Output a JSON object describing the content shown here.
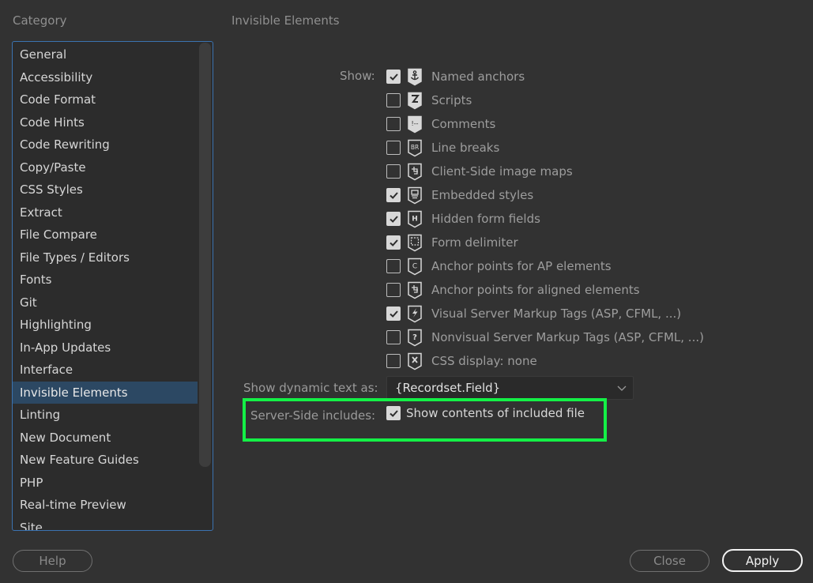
{
  "category": {
    "title": "Category",
    "items": [
      {
        "label": "General"
      },
      {
        "label": "Accessibility"
      },
      {
        "label": "Code Format"
      },
      {
        "label": "Code Hints"
      },
      {
        "label": "Code Rewriting"
      },
      {
        "label": "Copy/Paste"
      },
      {
        "label": "CSS Styles"
      },
      {
        "label": "Extract"
      },
      {
        "label": "File Compare"
      },
      {
        "label": "File Types / Editors"
      },
      {
        "label": "Fonts"
      },
      {
        "label": "Git"
      },
      {
        "label": "Highlighting"
      },
      {
        "label": "In-App Updates"
      },
      {
        "label": "Interface"
      },
      {
        "label": "Invisible Elements"
      },
      {
        "label": "Linting"
      },
      {
        "label": "New Document"
      },
      {
        "label": "New Feature Guides"
      },
      {
        "label": "PHP"
      },
      {
        "label": "Real-time Preview"
      },
      {
        "label": "Site"
      }
    ],
    "selected": "Invisible Elements"
  },
  "panel": {
    "title": "Invisible Elements",
    "show_label": "Show:",
    "options": [
      {
        "label": "Named anchors",
        "checked": true,
        "icon": "anchor-icon"
      },
      {
        "label": "Scripts",
        "checked": false,
        "icon": "script-icon"
      },
      {
        "label": "Comments",
        "checked": false,
        "icon": "comment-icon"
      },
      {
        "label": "Line breaks",
        "checked": false,
        "icon": "line-break-icon"
      },
      {
        "label": "Client-Side image maps",
        "checked": false,
        "icon": "image-map-icon"
      },
      {
        "label": "Embedded styles",
        "checked": true,
        "icon": "embedded-style-icon"
      },
      {
        "label": "Hidden form fields",
        "checked": true,
        "icon": "hidden-field-icon"
      },
      {
        "label": "Form delimiter",
        "checked": true,
        "icon": "form-delimiter-icon"
      },
      {
        "label": "Anchor points for AP elements",
        "checked": false,
        "icon": "ap-anchor-icon"
      },
      {
        "label": "Anchor points for aligned elements",
        "checked": false,
        "icon": "aligned-anchor-icon"
      },
      {
        "label": "Visual Server Markup Tags (ASP, CFML, ...)",
        "checked": true,
        "icon": "visual-server-tag-icon"
      },
      {
        "label": "Nonvisual Server Markup Tags (ASP, CFML, ...)",
        "checked": false,
        "icon": "nonvisual-server-tag-icon"
      },
      {
        "label": "CSS display: none",
        "checked": false,
        "icon": "css-display-none-icon"
      }
    ],
    "dynamic_text": {
      "label": "Show dynamic text as:",
      "value": "{Recordset.Field}"
    },
    "ssi": {
      "label": "Server-Side includes:",
      "checkbox_label": "Show contents of included file",
      "checked": true
    },
    "highlight_color": "#14f046"
  },
  "footer": {
    "help_label": "Help",
    "close_label": "Close",
    "apply_label": "Apply"
  }
}
